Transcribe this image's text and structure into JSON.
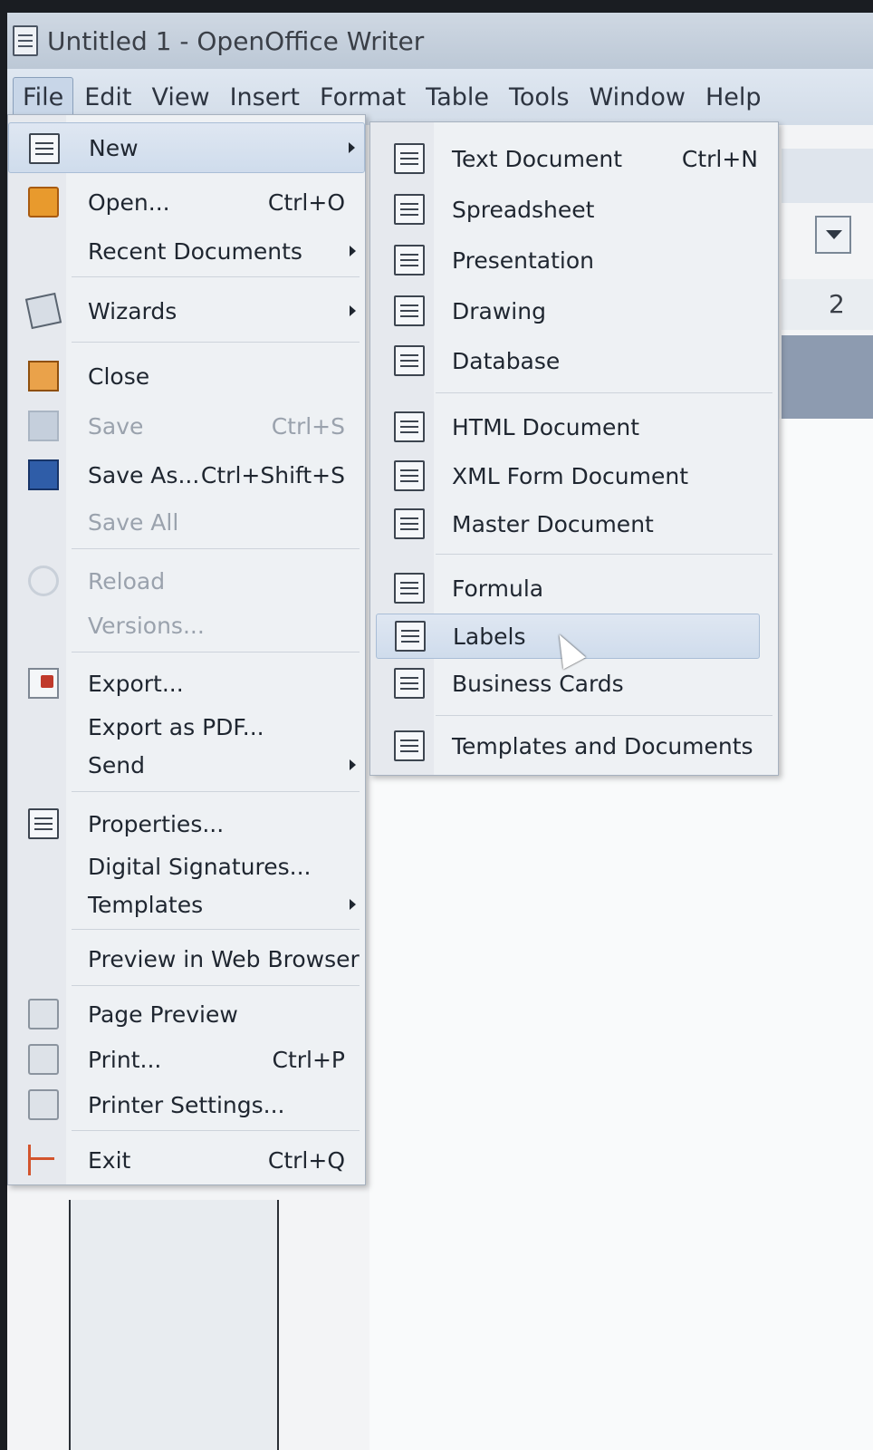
{
  "window": {
    "title": "Untitled 1 - OpenOffice Writer"
  },
  "menubar": [
    "File",
    "Edit",
    "View",
    "Insert",
    "Format",
    "Table",
    "Tools",
    "Window",
    "Help"
  ],
  "file_menu": [
    {
      "label": "New",
      "shortcut": "",
      "submenu": true,
      "icon": "new-document-icon",
      "disabled": false,
      "highlight": true
    },
    {
      "label": "Open...",
      "shortcut": "Ctrl+O",
      "icon": "folder-open-icon"
    },
    {
      "label": "Recent Documents",
      "shortcut": "",
      "submenu": true
    },
    {
      "label": "Wizards",
      "shortcut": "",
      "submenu": true,
      "icon": "wizard-icon"
    },
    {
      "label": "Close",
      "shortcut": "",
      "icon": "close-document-icon"
    },
    {
      "label": "Save",
      "shortcut": "Ctrl+S",
      "icon": "save-icon",
      "disabled": true
    },
    {
      "label": "Save As...",
      "shortcut": "Ctrl+Shift+S",
      "icon": "save-as-icon"
    },
    {
      "label": "Save All",
      "shortcut": "",
      "disabled": true
    },
    {
      "label": "Reload",
      "shortcut": "",
      "icon": "reload-icon",
      "disabled": true
    },
    {
      "label": "Versions...",
      "shortcut": "",
      "disabled": true
    },
    {
      "label": "Export...",
      "shortcut": "",
      "icon": "export-icon"
    },
    {
      "label": "Export as PDF...",
      "shortcut": ""
    },
    {
      "label": "Send",
      "shortcut": "",
      "submenu": true
    },
    {
      "label": "Properties...",
      "shortcut": "",
      "icon": "properties-icon"
    },
    {
      "label": "Digital Signatures...",
      "shortcut": ""
    },
    {
      "label": "Templates",
      "shortcut": "",
      "submenu": true
    },
    {
      "label": "Preview in Web Browser",
      "shortcut": ""
    },
    {
      "label": "Page Preview",
      "shortcut": "",
      "icon": "page-preview-icon"
    },
    {
      "label": "Print...",
      "shortcut": "Ctrl+P",
      "icon": "print-icon"
    },
    {
      "label": "Printer Settings...",
      "shortcut": "",
      "icon": "printer-settings-icon"
    },
    {
      "label": "Exit",
      "shortcut": "Ctrl+Q",
      "icon": "exit-icon"
    }
  ],
  "new_submenu": [
    {
      "label": "Text Document",
      "shortcut": "Ctrl+N",
      "icon": "text-document-icon"
    },
    {
      "label": "Spreadsheet",
      "shortcut": "",
      "icon": "spreadsheet-icon"
    },
    {
      "label": "Presentation",
      "shortcut": "",
      "icon": "presentation-icon"
    },
    {
      "label": "Drawing",
      "shortcut": "",
      "icon": "drawing-icon"
    },
    {
      "label": "Database",
      "shortcut": "",
      "icon": "database-icon"
    },
    {
      "label": "HTML Document",
      "shortcut": "",
      "icon": "html-document-icon"
    },
    {
      "label": "XML Form Document",
      "shortcut": "",
      "icon": "xml-form-icon"
    },
    {
      "label": "Master Document",
      "shortcut": "",
      "icon": "master-document-icon"
    },
    {
      "label": "Formula",
      "shortcut": "",
      "icon": "formula-icon"
    },
    {
      "label": "Labels",
      "shortcut": "",
      "icon": "labels-icon",
      "highlight": true
    },
    {
      "label": "Business Cards",
      "shortcut": "",
      "icon": "business-cards-icon"
    },
    {
      "label": "Templates and Documents",
      "shortcut": "",
      "icon": "templates-icon"
    }
  ],
  "ruler_number": "2"
}
